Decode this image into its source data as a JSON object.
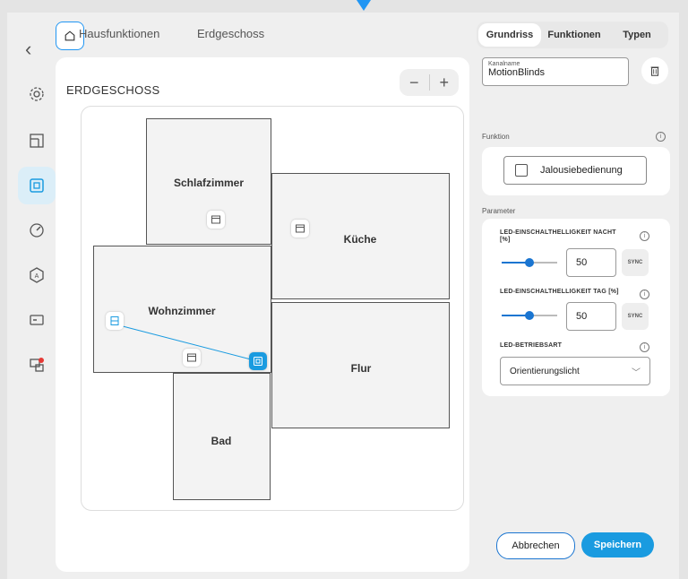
{
  "breadcrumb": {
    "items": [
      "Hausfunktionen",
      "Erdgeschoss"
    ]
  },
  "floor": {
    "title": "ERDGESCHOSS",
    "zoom_out": "−",
    "zoom_in": "+"
  },
  "rooms": {
    "schlafzimmer": "Schlafzimmer",
    "kueche": "Küche",
    "wohnzimmer": "Wohnzimmer",
    "flur": "Flur",
    "bad": "Bad"
  },
  "tabs": [
    "Grundriss",
    "Funktionen",
    "Typen"
  ],
  "channel": {
    "label": "Kanalname",
    "value": "MotionBlinds"
  },
  "function": {
    "section_label": "Funktion",
    "value": "Jalousiebedienung"
  },
  "parameters": {
    "section_label": "Parameter",
    "led_night": {
      "label": "LED-EINSCHALTHELLIGKEIT NACHT [%]",
      "value": "50",
      "level_percent": 50
    },
    "led_day": {
      "label": "LED-EINSCHALTHELLIGKEIT TAG [%]",
      "value": "50",
      "level_percent": 50
    },
    "sync_label": "SYNC",
    "mode": {
      "label": "LED-BETRIEBSART",
      "value": "Orientierungslicht"
    }
  },
  "actions": {
    "cancel": "Abbrechen",
    "save": "Speichern"
  },
  "colors": {
    "accent": "#1a9be0",
    "accent_dark": "#1a75d1",
    "marker": "#2196f3"
  }
}
